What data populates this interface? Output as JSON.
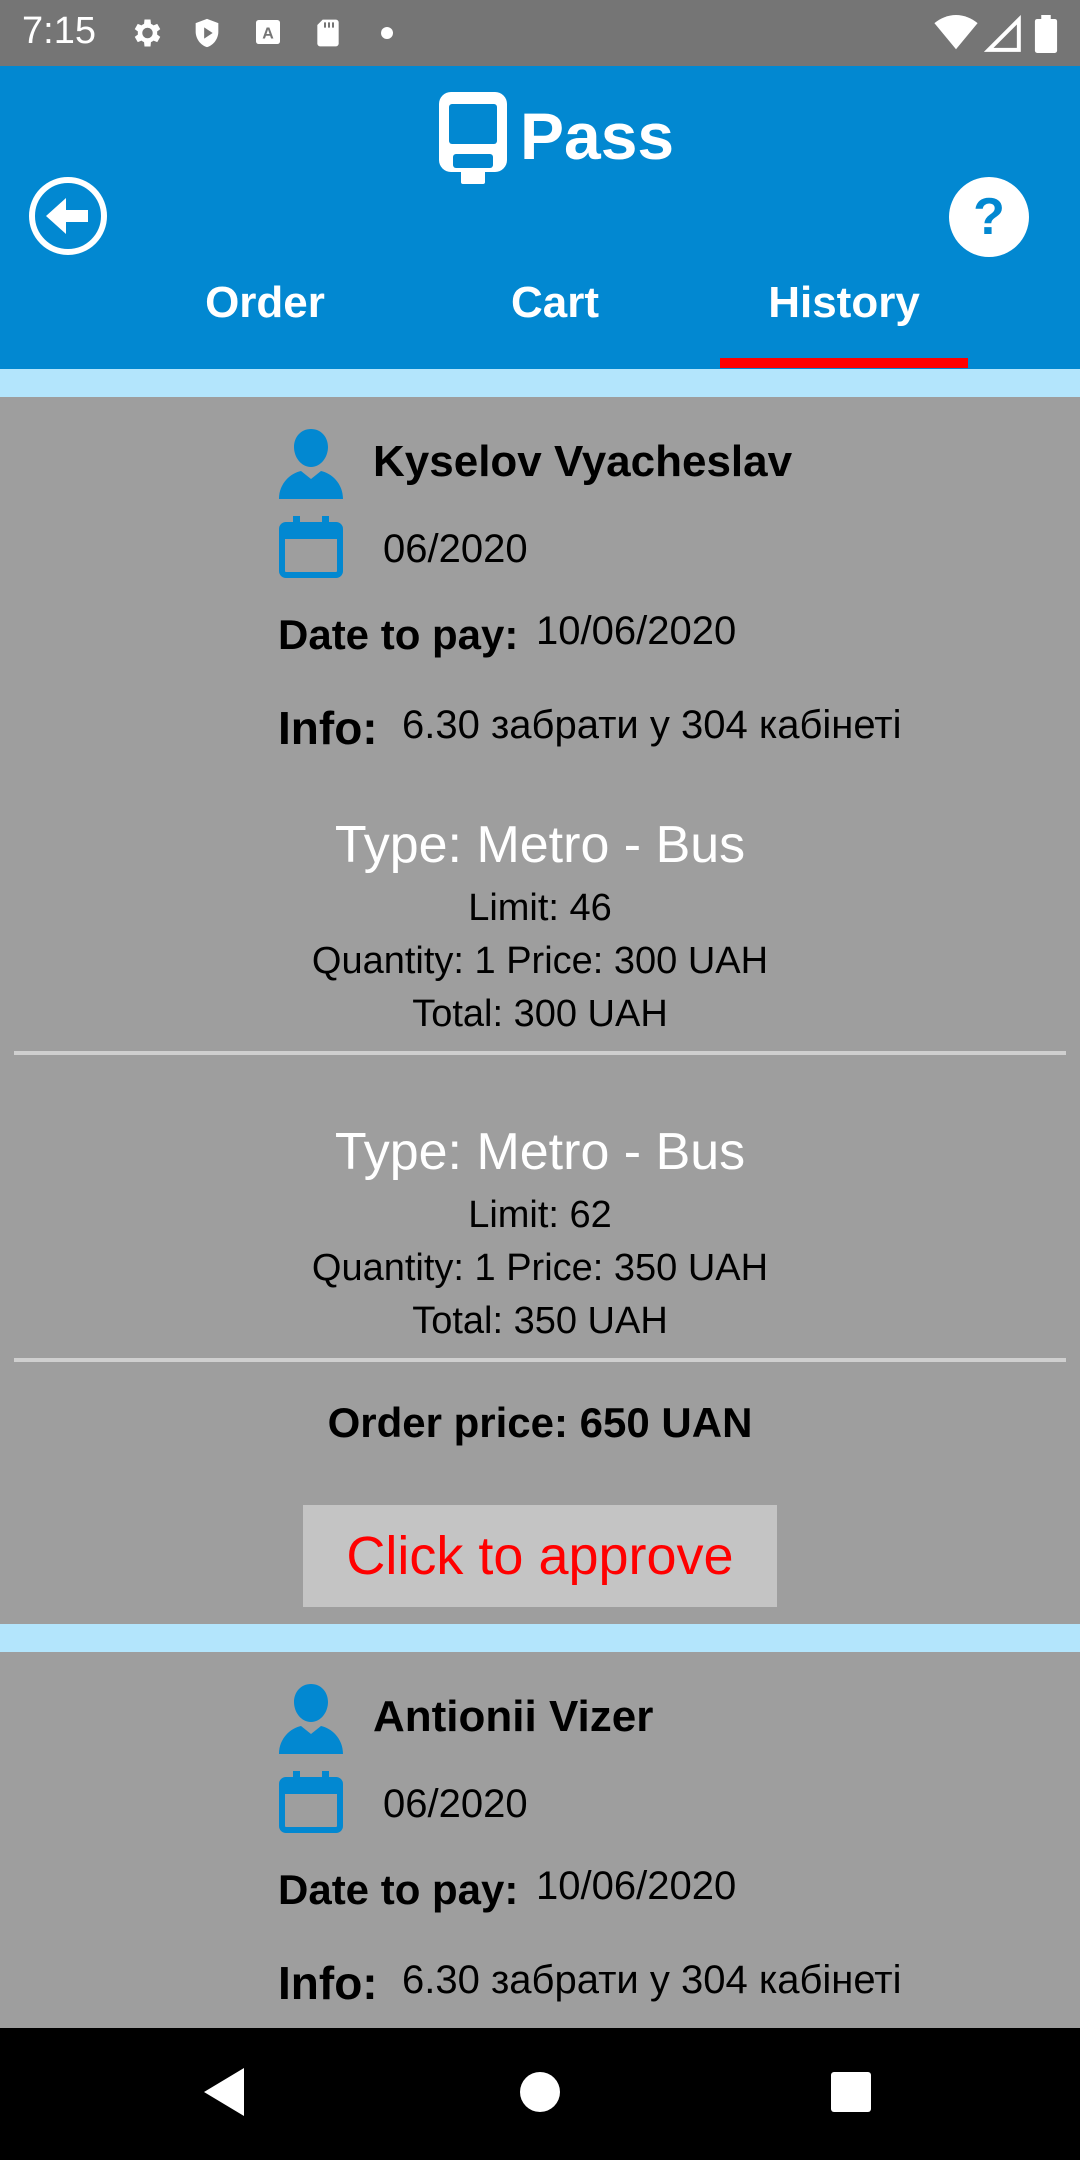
{
  "status_bar": {
    "time": "7:15",
    "left_icons": [
      "settings-icon",
      "shield-icon",
      "keyboard-a-icon",
      "sd-card-icon",
      "dot-icon"
    ],
    "right_icons": [
      "wifi-icon",
      "signal-icon",
      "battery-icon"
    ]
  },
  "header": {
    "title": "Pass",
    "logo_icon": "bus-icon",
    "back_icon": "back-arrow-icon",
    "help_icon": "help-question-icon"
  },
  "tabs": [
    {
      "label": "Order",
      "active": false
    },
    {
      "label": "Cart",
      "active": false
    },
    {
      "label": "History",
      "active": true
    }
  ],
  "colors": {
    "primary": "#0288d1",
    "tab_indicator": "#ff0000",
    "separator": "#b3e5fc",
    "card_background": "#9e9e9e",
    "approve_text": "#ff0000"
  },
  "orders": [
    {
      "name": "Kyselov Vyacheslav",
      "period": "06/2020",
      "date_to_pay_label": "Date to pay:",
      "date_to_pay": "10/06/2020",
      "info_label": "Info:",
      "info": "6.30 забрати у 304 кабінеті",
      "items": [
        {
          "type": "Type: Metro - Bus",
          "limit": "Limit:  46",
          "qty_price": "Quantity:  1 Price:  300 UAH",
          "total": "Total: 300 UAH"
        },
        {
          "type": "Type: Metro - Bus",
          "limit": "Limit:  62",
          "qty_price": "Quantity:  1 Price:  350 UAH",
          "total": "Total: 350 UAH"
        }
      ],
      "order_price": "Order price: 650 UAN",
      "approve_label": "Click to approve"
    },
    {
      "name": "Antionii Vizer",
      "period": "06/2020",
      "date_to_pay_label": "Date to pay:",
      "date_to_pay": "10/06/2020",
      "info_label": "Info:",
      "info": "6.30 забрати у 304 кабінеті"
    }
  ],
  "nav_bar": {
    "icons": [
      "back-triangle-icon",
      "home-circle-icon",
      "recents-square-icon"
    ]
  }
}
